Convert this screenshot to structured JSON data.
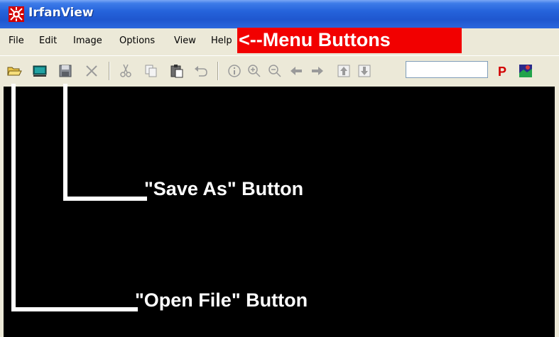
{
  "window": {
    "title": "IrfanView"
  },
  "menu": {
    "items": [
      {
        "id": "file",
        "label": "File"
      },
      {
        "id": "edit",
        "label": "Edit"
      },
      {
        "id": "image",
        "label": "Image"
      },
      {
        "id": "options",
        "label": "Options"
      },
      {
        "id": "view",
        "label": "View"
      },
      {
        "id": "help",
        "label": "Help"
      }
    ]
  },
  "toolbar": {
    "buttons": [
      {
        "name": "open-file-icon",
        "tooltip_hint": "Open"
      },
      {
        "name": "slideshow-icon",
        "tooltip_hint": "Slideshow"
      },
      {
        "name": "save-icon",
        "tooltip_hint": "Save As"
      },
      {
        "name": "delete-icon",
        "tooltip_hint": "Delete"
      },
      {
        "name": "cut-icon",
        "tooltip_hint": "Cut"
      },
      {
        "name": "copy-icon",
        "tooltip_hint": "Copy"
      },
      {
        "name": "paste-icon",
        "tooltip_hint": "Paste"
      },
      {
        "name": "undo-icon",
        "tooltip_hint": "Undo"
      },
      {
        "name": "info-icon",
        "tooltip_hint": "Info"
      },
      {
        "name": "zoom-in-icon",
        "tooltip_hint": "Zoom in"
      },
      {
        "name": "zoom-out-icon",
        "tooltip_hint": "Zoom out"
      },
      {
        "name": "previous-icon",
        "tooltip_hint": "Previous"
      },
      {
        "name": "next-icon",
        "tooltip_hint": "Next"
      },
      {
        "name": "first-icon",
        "tooltip_hint": "First"
      },
      {
        "name": "last-icon",
        "tooltip_hint": "Last"
      },
      {
        "name": "print-icon",
        "tooltip_hint": "Print"
      },
      {
        "name": "about-icon",
        "tooltip_hint": "About"
      }
    ],
    "page_input_value": ""
  },
  "annotations": {
    "menu_buttons": "<--Menu Buttons",
    "save_as": "\"Save As\" Button",
    "open_file": "\"Open File\" Button"
  },
  "colors": {
    "titlebar": "#2563db",
    "menubar": "#ece9d8",
    "canvas": "#000000",
    "annotation_banner": "#f20000",
    "annotation_text": "#ffffff"
  }
}
